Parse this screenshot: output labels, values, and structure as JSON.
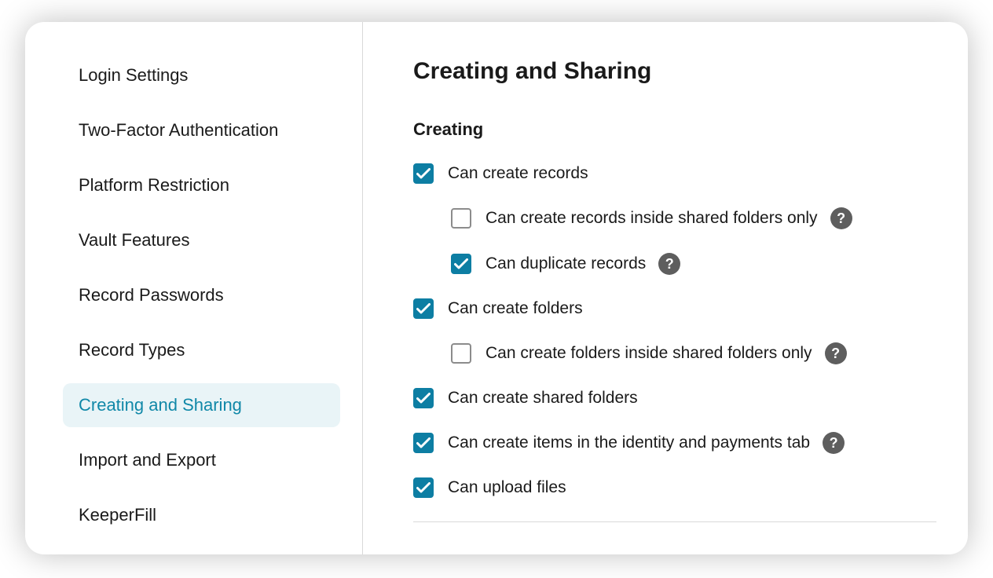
{
  "sidebar": {
    "items": [
      {
        "label": "Login Settings",
        "active": false
      },
      {
        "label": "Two-Factor Authentication",
        "active": false
      },
      {
        "label": "Platform Restriction",
        "active": false
      },
      {
        "label": "Vault Features",
        "active": false
      },
      {
        "label": "Record Passwords",
        "active": false
      },
      {
        "label": "Record Types",
        "active": false
      },
      {
        "label": "Creating and Sharing",
        "active": true
      },
      {
        "label": "Import and Export",
        "active": false
      },
      {
        "label": "KeeperFill",
        "active": false
      }
    ]
  },
  "main": {
    "title": "Creating and Sharing",
    "group_title": "Creating",
    "options": [
      {
        "label": "Can create records",
        "checked": true,
        "sub": false,
        "help": false
      },
      {
        "label": "Can create records inside shared folders only",
        "checked": false,
        "sub": true,
        "help": true
      },
      {
        "label": "Can duplicate records",
        "checked": true,
        "sub": true,
        "help": true
      },
      {
        "label": "Can create folders",
        "checked": true,
        "sub": false,
        "help": false
      },
      {
        "label": "Can create folders inside shared folders only",
        "checked": false,
        "sub": true,
        "help": true
      },
      {
        "label": "Can create shared folders",
        "checked": true,
        "sub": false,
        "help": false
      },
      {
        "label": "Can create items in the identity and payments tab",
        "checked": true,
        "sub": false,
        "help": true
      },
      {
        "label": "Can upload files",
        "checked": true,
        "sub": false,
        "help": false
      }
    ]
  }
}
